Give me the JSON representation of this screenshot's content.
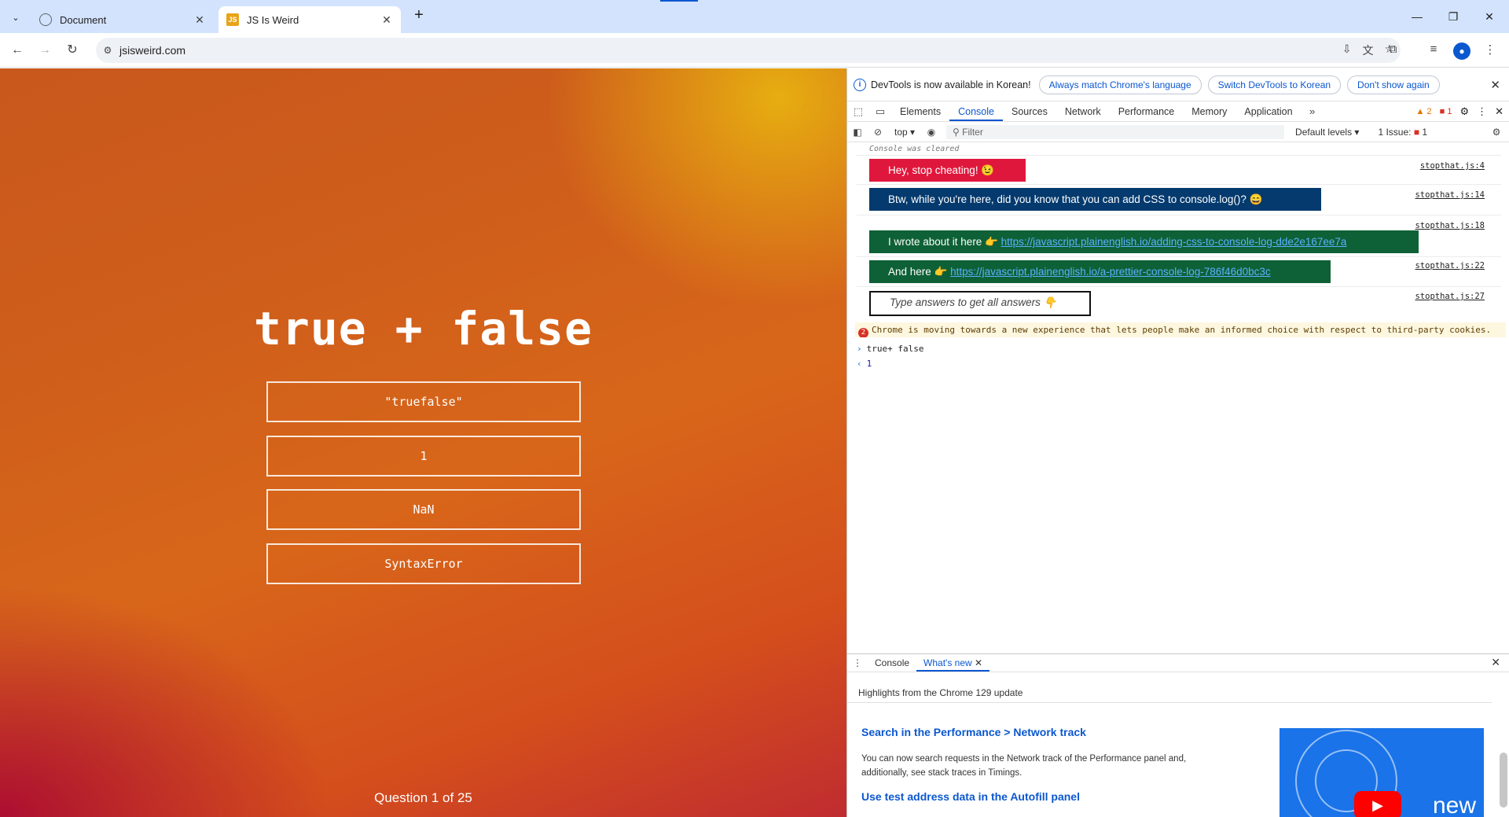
{
  "browser": {
    "tabs": [
      {
        "title": "Document",
        "active": false
      },
      {
        "title": "JS Is Weird",
        "active": true
      }
    ],
    "favicon_js": "JS",
    "new_tab": "+",
    "url": "jsisweird.com"
  },
  "page": {
    "question": "true + false",
    "answers": [
      "\"truefalse\"",
      "1",
      "NaN",
      "SyntaxError"
    ],
    "progress": "Question 1 of 25"
  },
  "devtools": {
    "infobar": {
      "message": "DevTools is now available in Korean!",
      "buttons": [
        "Always match Chrome's language",
        "Switch DevTools to Korean",
        "Don't show again"
      ]
    },
    "tabs": [
      "Elements",
      "Console",
      "Sources",
      "Network",
      "Performance",
      "Memory",
      "Application"
    ],
    "selected_tab": "Console",
    "warnings_count": "2",
    "errors_count": "1",
    "console_toolbar": {
      "context": "top",
      "filter_placeholder": "Filter",
      "levels": "Default levels",
      "issues_label": "1 Issue:",
      "issues_count": "1"
    },
    "console": {
      "cleared": "Console was cleared",
      "messages": [
        {
          "text": "Hey, stop cheating! 😉",
          "source": "stopthat.js:4"
        },
        {
          "text": "Btw, while you're here, did you know that you can add CSS to console.log()? 😄",
          "source": "stopthat.js:14"
        },
        {
          "text": "I wrote about it here 👉",
          "link": "https://javascript.plainenglish.io/adding-css-to-console-log-dde2e167ee7a",
          "source": "stopthat.js:18"
        },
        {
          "text": "And here 👉",
          "link": "https://javascript.plainenglish.io/a-prettier-console-log-786f46d0bc3c",
          "source": "stopthat.js:22"
        },
        {
          "text": "Type answers to get all answers 👇",
          "source": "stopthat.js:27"
        }
      ],
      "warning": "Chrome is moving towards a new experience that lets people make an informed choice with respect to third-party cookies.",
      "input": "true+ false",
      "result": "1"
    },
    "drawer": {
      "tabs": [
        "Console",
        "What's new"
      ],
      "selected": "What's new",
      "subtitle": "Highlights from the Chrome 129 update",
      "items": [
        {
          "title": "Search in the Performance > Network track",
          "body": "You can now search requests in the Network track of the Performance panel and, additionally, see stack traces in Timings."
        },
        {
          "title": "Use test address data in the Autofill panel"
        }
      ],
      "video_label": "new"
    }
  },
  "colors": {
    "accent": "#0b57d0",
    "log_red": "#e0173c",
    "log_navy": "#043a6e",
    "log_green": "#0e6136"
  }
}
